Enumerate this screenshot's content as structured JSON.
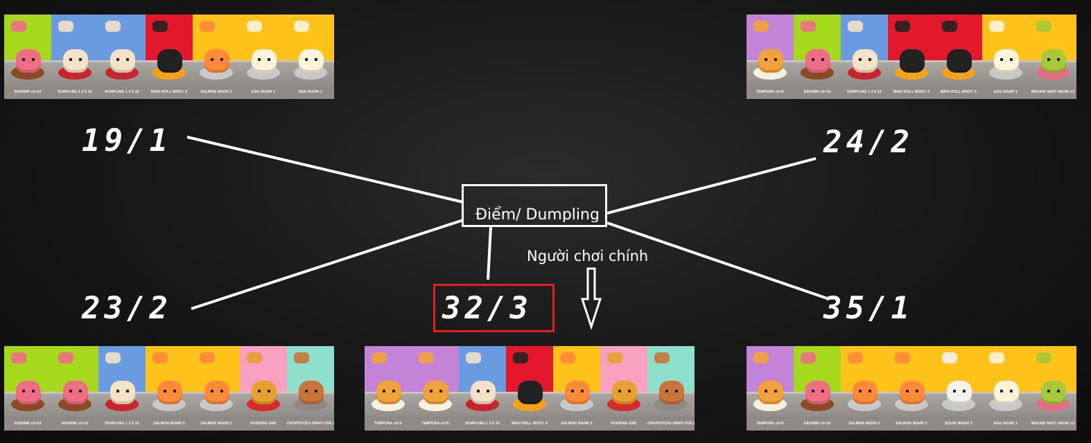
{
  "center_label": "Điểm/ Dumpling",
  "main_player_label": "Người chơi chính",
  "scores": {
    "top_left": "19/1",
    "top_right": "24/2",
    "bottom_left": "23/2",
    "main": "32/3",
    "bottom_right": "35/1"
  },
  "colors": {
    "highlight": "#e02020",
    "sashimi": "#a6d81e",
    "dumpling": "#6a9be0",
    "maki": "#e3182c",
    "nigiri": "#ffc21a",
    "tempura": "#c383d6",
    "pudding": "#f7a0c0",
    "chopsticks": "#8ee0cc"
  },
  "hands": {
    "top_left": [
      {
        "kind": "sashimi",
        "caption": "SASHIMI x3=10"
      },
      {
        "kind": "dumpling",
        "caption": "DUMPLING 1 3 6 10"
      },
      {
        "kind": "dumpling",
        "caption": "DUMPLING 1 3 6 10"
      },
      {
        "kind": "maki",
        "caption": "MAKI ROLL MOST: 6"
      },
      {
        "kind": "salmon",
        "caption": "SALMON NIGIRI 2"
      },
      {
        "kind": "egg",
        "caption": "EGG NIGIRI 1"
      },
      {
        "kind": "egg",
        "caption": "EGG NIGIRI 1"
      }
    ],
    "top_right": [
      {
        "kind": "tempura",
        "caption": "TEMPURA x2=5"
      },
      {
        "kind": "sashimi",
        "caption": "SASHIMI x3=10"
      },
      {
        "kind": "dumpling",
        "caption": "DUMPLING 1 3 6 10"
      },
      {
        "kind": "maki",
        "caption": "MAKI ROLL MOST: 6"
      },
      {
        "kind": "maki",
        "caption": "MAKI ROLL MOST: 6"
      },
      {
        "kind": "egg",
        "caption": "EGG NIGIRI 1"
      },
      {
        "kind": "wasabi",
        "caption": "WASABI NEXT NIGIRI x3"
      }
    ],
    "bottom_left": [
      {
        "kind": "sashimi",
        "caption": "SASHIMI x3=10"
      },
      {
        "kind": "sashimi",
        "caption": "SASHIMI x3=10"
      },
      {
        "kind": "dumpling",
        "caption": "DUMPLING 1 3 6 10"
      },
      {
        "kind": "salmon",
        "caption": "SALMON NIGIRI 2"
      },
      {
        "kind": "salmon",
        "caption": "SALMON NIGIRI 2"
      },
      {
        "kind": "pudding",
        "caption": "PUDDING END"
      },
      {
        "kind": "chopsticks",
        "caption": "CHOPSTICKS SWAP FOR 2"
      }
    ],
    "main": [
      {
        "kind": "tempura",
        "caption": "TEMPURA x2=5"
      },
      {
        "kind": "tempura",
        "caption": "TEMPURA x2=5"
      },
      {
        "kind": "dumpling",
        "caption": "DUMPLING 1 3 6 10"
      },
      {
        "kind": "maki",
        "caption": "MAKI ROLL MOST: 6"
      },
      {
        "kind": "salmon",
        "caption": "SALMON NIGIRI 2"
      },
      {
        "kind": "pudding",
        "caption": "PUDDING END"
      },
      {
        "kind": "chopsticks",
        "caption": "CHOPSTICKS SWAP FOR 2"
      }
    ],
    "bottom_right": [
      {
        "kind": "tempura",
        "caption": "TEMPURA x2=5"
      },
      {
        "kind": "sashimi",
        "caption": "SASHIMI x3=10"
      },
      {
        "kind": "salmon",
        "caption": "SALMON NIGIRI 2"
      },
      {
        "kind": "salmon",
        "caption": "SALMON NIGIRI 2"
      },
      {
        "kind": "squid",
        "caption": "SQUID NIGIRI 3"
      },
      {
        "kind": "egg",
        "caption": "EGG NIGIRI 1"
      },
      {
        "kind": "wasabi",
        "caption": "WASABI NEXT NIGIRI x3"
      }
    ]
  }
}
